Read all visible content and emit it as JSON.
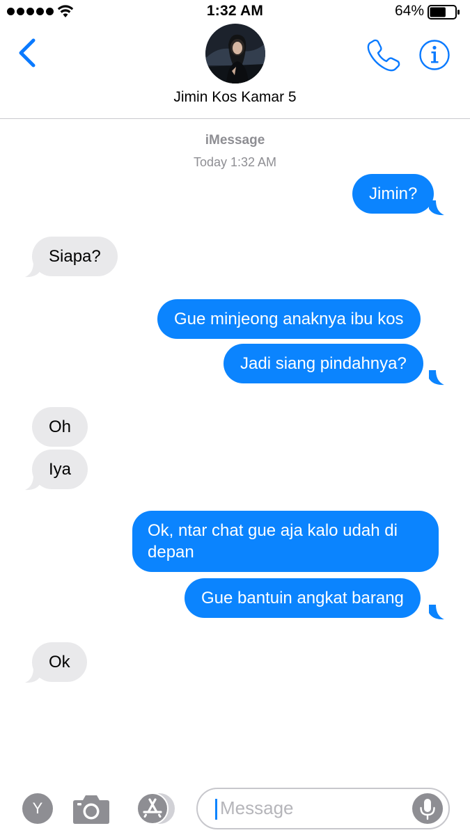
{
  "status_bar": {
    "time": "1:32 AM",
    "battery_percent": "64%",
    "battery_level": 0.64,
    "signal_dots": 5
  },
  "header": {
    "contact_name": "Jimin Kos Kamar 5",
    "back_icon": "chevron-left-icon",
    "phone_icon": "phone-icon",
    "info_icon": "info-icon"
  },
  "conversation": {
    "service": "iMessage",
    "timestamp": "Today 1:32 AM",
    "messages": [
      {
        "direction": "outgoing",
        "text": "Jimin?"
      },
      {
        "direction": "incoming",
        "text": "Siapa?"
      },
      {
        "direction": "outgoing",
        "text": "Gue minjeong anaknya ibu kos"
      },
      {
        "direction": "outgoing",
        "text": "Jadi siang pindahnya?"
      },
      {
        "direction": "incoming",
        "text": "Oh"
      },
      {
        "direction": "incoming",
        "text": "Iya"
      },
      {
        "direction": "outgoing",
        "text": "Ok, ntar chat gue aja kalo udah di depan"
      },
      {
        "direction": "outgoing",
        "text": "Gue bantuin angkat barang"
      },
      {
        "direction": "incoming",
        "text": "Ok"
      }
    ]
  },
  "input_bar": {
    "app_button_label": "Y",
    "placeholder": "Message",
    "icons": [
      "camera-icon",
      "app-store-icon",
      "microphone-icon"
    ]
  },
  "colors": {
    "outgoing_bubble": "#0b84fe",
    "incoming_bubble": "#e9e9eb",
    "accent": "#0a7aff",
    "muted_text": "#8e8e93"
  }
}
